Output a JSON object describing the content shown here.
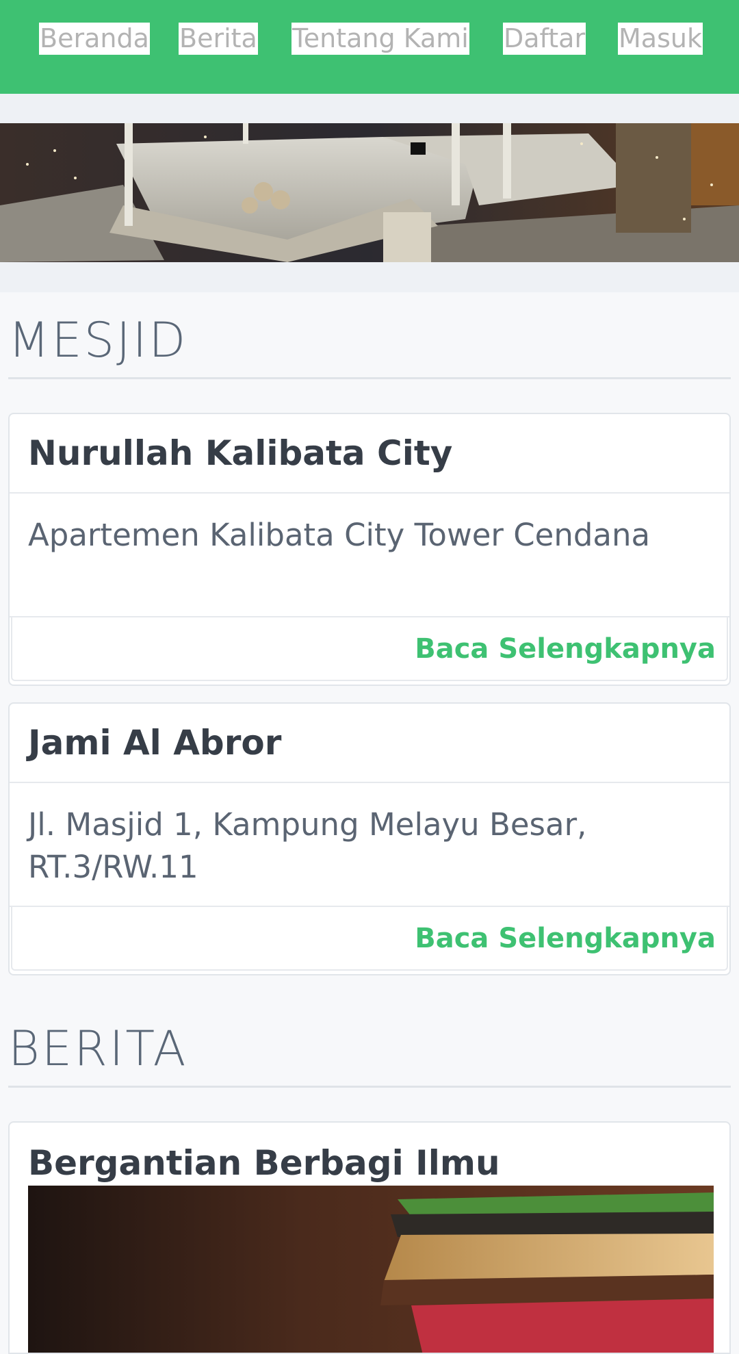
{
  "nav": {
    "items": [
      {
        "label": "Beranda"
      },
      {
        "label": "Berita"
      },
      {
        "label": "Tentang Kami"
      },
      {
        "label": "Daftar"
      },
      {
        "label": "Masuk"
      }
    ]
  },
  "sections": {
    "mesjid": {
      "title": "MESJID"
    },
    "berita": {
      "title": "BERITA"
    }
  },
  "mosques": [
    {
      "name": "Nurullah Kalibata City",
      "address": "Apartemen Kalibata City Tower Cendana",
      "read_more": "Baca Selengkapnya"
    },
    {
      "name": "Jami Al Abror",
      "address": "Jl. Masjid 1, Kampung Melayu Besar, RT.3/RW.11",
      "read_more": "Baca Selengkapnya"
    }
  ],
  "news": [
    {
      "title": "Bergantian Berbagi Ilmu"
    }
  ],
  "colors": {
    "brand_green": "#3ec172",
    "nav_text": "#b3b3b3",
    "heading_text": "#363d47"
  }
}
